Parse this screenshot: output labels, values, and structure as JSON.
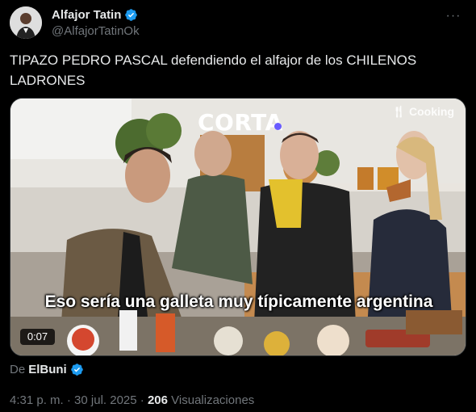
{
  "author": {
    "display_name": "Alfajor Tatin",
    "handle": "@AlfajorTatinOk",
    "verified": true,
    "verified_color": "#1d9bf0"
  },
  "more_menu": {
    "icon": "more-horizontal-icon",
    "label": "···"
  },
  "tweet": {
    "text": "TIPAZO PEDRO PASCAL defendiendo el alfajor de los CHILENOS LADRONES"
  },
  "media": {
    "brand_left": "CORTA",
    "brand_right": "Cooking",
    "subtitle": "Eso sería una galleta muy típicamente argentina",
    "duration": "0:07"
  },
  "source": {
    "prefix": "De",
    "name": "ElBuni",
    "verified": true
  },
  "meta": {
    "time": "4:31 p. m.",
    "separator": "·",
    "date": "30 jul. 2025",
    "views_count": "206",
    "views_label": "Visualizaciones"
  },
  "colors": {
    "background": "#000000",
    "text_primary": "#e7e9ea",
    "text_secondary": "#71767b",
    "accent": "#1d9bf0"
  }
}
